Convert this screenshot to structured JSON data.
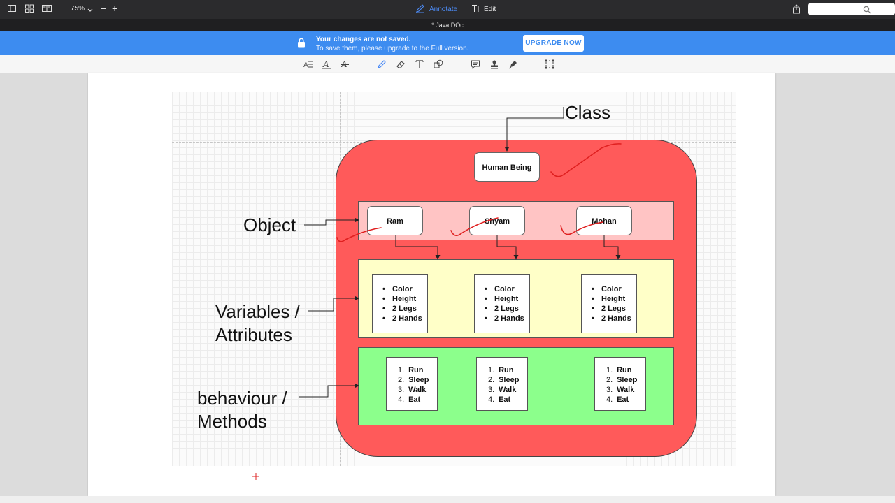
{
  "toolbar": {
    "zoom_label": "75%",
    "annotate_label": "Annotate",
    "edit_label": "Edit",
    "zoom_minus": "−",
    "zoom_plus": "+"
  },
  "document": {
    "title": "* Java DOc"
  },
  "banner": {
    "title": "Your changes are not saved.",
    "subtitle": "To save them, please upgrade to the Full version.",
    "upgrade_label": "UPGRADE NOW",
    "color": "#3d8cf0"
  },
  "annotation_tools": [
    "text-style-icon",
    "underline-text-icon",
    "strikethrough-text-icon",
    "pencil-icon",
    "eraser-icon",
    "text-tool-icon",
    "shapes-icon",
    "comment-icon",
    "stamp-icon",
    "signature-pen-icon",
    "selection-icon"
  ],
  "diagram": {
    "class_label": "Class",
    "class_box": "Human Being",
    "object_label": "Object",
    "variables_label_line1": "Variables /",
    "variables_label_line2": "Attributes",
    "behaviour_label_line1": "behaviour /",
    "behaviour_label_line2": "Methods",
    "objects": [
      "Ram",
      "Shyam",
      "Mohan"
    ],
    "attributes": [
      [
        "Color",
        "Height",
        "2 Legs",
        "2 Hands"
      ],
      [
        "Color",
        "Height",
        "2 Legs",
        "2 Hands"
      ],
      [
        "Color",
        "Height",
        "2 Legs",
        "2 Hands"
      ]
    ],
    "methods": [
      [
        "Run",
        "Sleep",
        "Walk",
        "Eat"
      ],
      [
        "Run",
        "Sleep",
        "Walk",
        "Eat"
      ],
      [
        "Run",
        "Sleep",
        "Walk",
        "Eat"
      ]
    ],
    "method_numbers": [
      "1.",
      "2.",
      "3.",
      "4."
    ],
    "colors": {
      "class_container": "#ff5a5a",
      "object_band": "#ffc4c4",
      "attribute_band": "#ffffc8",
      "method_band": "#8cff8c",
      "annotation_ink": "#e02020"
    }
  }
}
